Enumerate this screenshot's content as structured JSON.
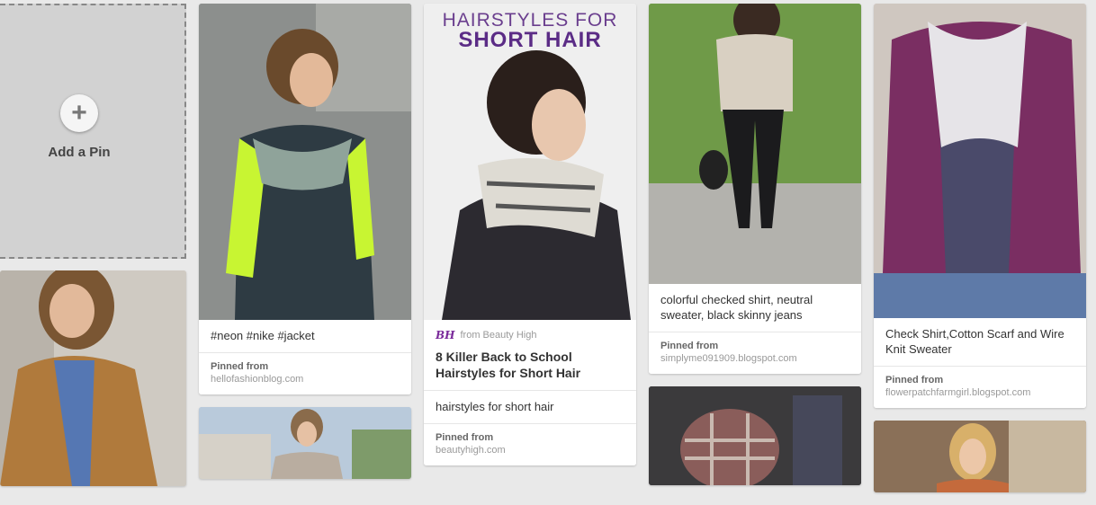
{
  "add_pin": {
    "icon": "plus-icon",
    "label": "Add a Pin"
  },
  "pins": {
    "neon_jacket": {
      "image": "person-neon-jacket-image",
      "description": "#neon #nike #jacket",
      "pinned_label": "Pinned from",
      "source": "hellofashionblog.com"
    },
    "short_hair": {
      "overlay_line1": "HAIRSTYLES FOR",
      "overlay_line2": "SHORT HAIR",
      "from_logo": "BH",
      "from_text": "from Beauty High",
      "title": "8 Killer Back to School Hairstyles for Short Hair",
      "description": "hairstyles for short hair",
      "pinned_label": "Pinned from",
      "source": "beautyhigh.com"
    },
    "checked_shirt": {
      "description": "colorful checked shirt, neutral sweater, black skinny jeans",
      "pinned_label": "Pinned from",
      "source": "simplyme091909.blogspot.com"
    },
    "scarf_sweater": {
      "description": "Check Shirt,Cotton Scarf and Wire Knit Sweater",
      "pinned_label": "Pinned from",
      "source": "flowerpatchfarmgirl.blogspot.com"
    }
  },
  "colors": {
    "background": "#e9e9e9",
    "accent_purple": "#5b2c86"
  }
}
